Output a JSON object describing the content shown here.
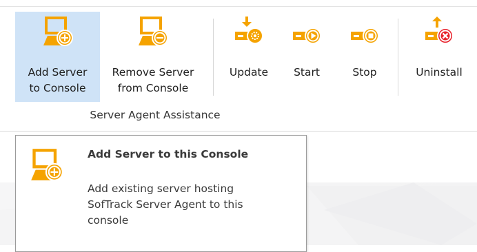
{
  "ribbon": {
    "buttons": [
      {
        "label1": "Add Server",
        "label2": "to Console",
        "icon": "add-server-icon"
      },
      {
        "label1": "Remove Server",
        "label2": "from Console",
        "icon": "remove-server-icon"
      },
      {
        "label1": "Update",
        "icon": "update-agent-icon"
      },
      {
        "label1": "Start",
        "icon": "start-agent-icon"
      },
      {
        "label1": "Stop",
        "icon": "stop-agent-icon"
      },
      {
        "label1": "Uninstall",
        "icon": "uninstall-agent-icon"
      }
    ],
    "group_label": "Server Agent Assistance"
  },
  "tooltip": {
    "title": "Add Server to this Console",
    "description_lines": [
      "Add existing server hosting",
      "SofTrack Server Agent to this",
      "console"
    ]
  },
  "colors": {
    "icon_orange": "#f5a300",
    "active_background": "#cfe3f7",
    "uninstall_red": "#e8202a"
  }
}
